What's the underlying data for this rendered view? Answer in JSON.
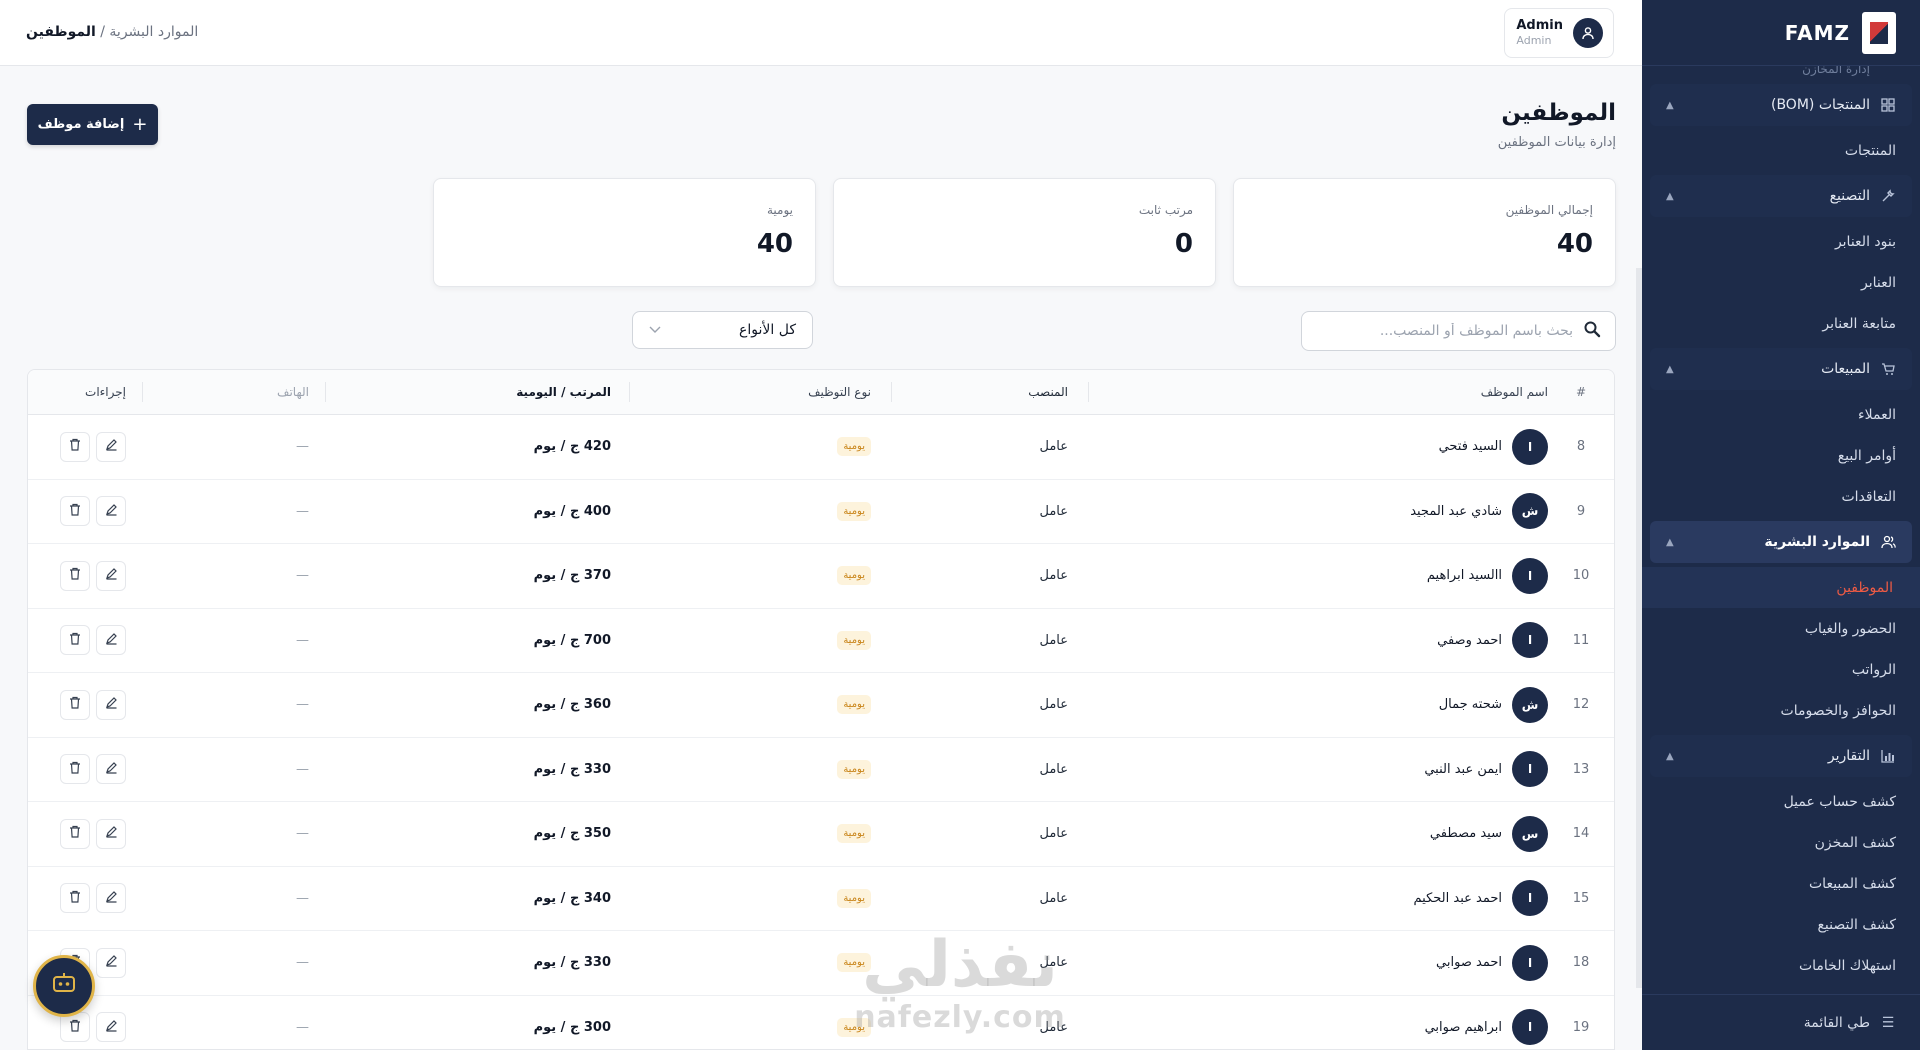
{
  "brand": "FAMZ",
  "breadcrumb": {
    "parent": "الموارد البشرية",
    "separator": " / ",
    "current": "الموظفين"
  },
  "user": {
    "name": "Admin",
    "role": "Admin"
  },
  "page": {
    "title": "الموظفين",
    "subtitle": "إدارة بيانات الموظفين",
    "add_button": "إضافة موظف"
  },
  "stats": [
    {
      "label": "إجمالي الموظفين",
      "value": "40"
    },
    {
      "label": "مرتب ثابت",
      "value": "0"
    },
    {
      "label": "يومية",
      "value": "40"
    }
  ],
  "search": {
    "placeholder": "بحث باسم الموظف أو المنصب..."
  },
  "filter": {
    "selected": "كل الأنواع"
  },
  "sidebar": {
    "cut_text": "إدارة المخازن",
    "sections": [
      {
        "label": "المنتجات (BOM)",
        "icon": "grid-icon",
        "items": [
          "المنتجات"
        ]
      },
      {
        "label": "التصنيع",
        "icon": "wrench-icon",
        "items": [
          "بنود العنابر",
          "العنابر",
          "متابعة العنابر"
        ]
      },
      {
        "label": "المبيعات",
        "icon": "cart-icon",
        "items": [
          "العملاء",
          "أوامر البيع",
          "التعاقدات"
        ]
      },
      {
        "label": "الموارد البشرية",
        "icon": "people-icon",
        "items": [
          "الموظفين",
          "الحضور والغياب",
          "الرواتب",
          "الحوافز والخصومات"
        ]
      },
      {
        "label": "التقارير",
        "icon": "chart-icon",
        "items": [
          "كشف حساب عميل",
          "كشف المخزن",
          "كشف المبيعات",
          "كشف التصنيع",
          "استهلاك الخامات"
        ]
      }
    ],
    "active_item": "الموظفين",
    "collapse": "طي القائمة"
  },
  "table": {
    "headers": {
      "num": "#",
      "name": "اسم الموظف",
      "position": "المنصب",
      "type": "نوع التوظيف",
      "salary": "المرتب / اليومية",
      "phone": "الهاتف",
      "actions": "إجراءات"
    },
    "rows": [
      {
        "num": "8",
        "initial": "ا",
        "name": "السيد فتحي",
        "position": "عامل",
        "type": "يومية",
        "salary": "420 ج / يوم",
        "phone": "—"
      },
      {
        "num": "9",
        "initial": "ش",
        "name": "شادي عبد المجيد",
        "position": "عامل",
        "type": "يومية",
        "salary": "400 ج / يوم",
        "phone": "—"
      },
      {
        "num": "10",
        "initial": "ا",
        "name": "االسيد ابراهيم",
        "position": "عامل",
        "type": "يومية",
        "salary": "370 ج / يوم",
        "phone": "—"
      },
      {
        "num": "11",
        "initial": "ا",
        "name": "احمد وصفي",
        "position": "عامل",
        "type": "يومية",
        "salary": "700 ج / يوم",
        "phone": "—"
      },
      {
        "num": "12",
        "initial": "ش",
        "name": "شحته جمال",
        "position": "عامل",
        "type": "يومية",
        "salary": "360 ج / يوم",
        "phone": "—"
      },
      {
        "num": "13",
        "initial": "ا",
        "name": "ايمن عبد النبي",
        "position": "عامل",
        "type": "يومية",
        "salary": "330 ج / يوم",
        "phone": "—"
      },
      {
        "num": "14",
        "initial": "س",
        "name": "سيد مصطفي",
        "position": "عامل",
        "type": "يومية",
        "salary": "350 ج / يوم",
        "phone": "—"
      },
      {
        "num": "15",
        "initial": "ا",
        "name": "احمد عبد الحكيم",
        "position": "عامل",
        "type": "يومية",
        "salary": "340 ج / يوم",
        "phone": "—"
      },
      {
        "num": "18",
        "initial": "ا",
        "name": "احمد صوابي",
        "position": "عامل",
        "type": "يومية",
        "salary": "330 ج / يوم",
        "phone": "—"
      },
      {
        "num": "19",
        "initial": "ا",
        "name": "ابراهيم صوابي",
        "position": "عامل",
        "type": "يومية",
        "salary": "300 ج / يوم",
        "phone": "—"
      }
    ]
  },
  "watermark": {
    "arabic": "نفذلي",
    "latin": "nafezly.com"
  },
  "colors": {
    "navy": "#1d2b49",
    "accent": "#ef5b44",
    "badge_bg": "#fdf3dc",
    "badge_text": "#c9851a",
    "fab_ring": "#e0b448"
  }
}
